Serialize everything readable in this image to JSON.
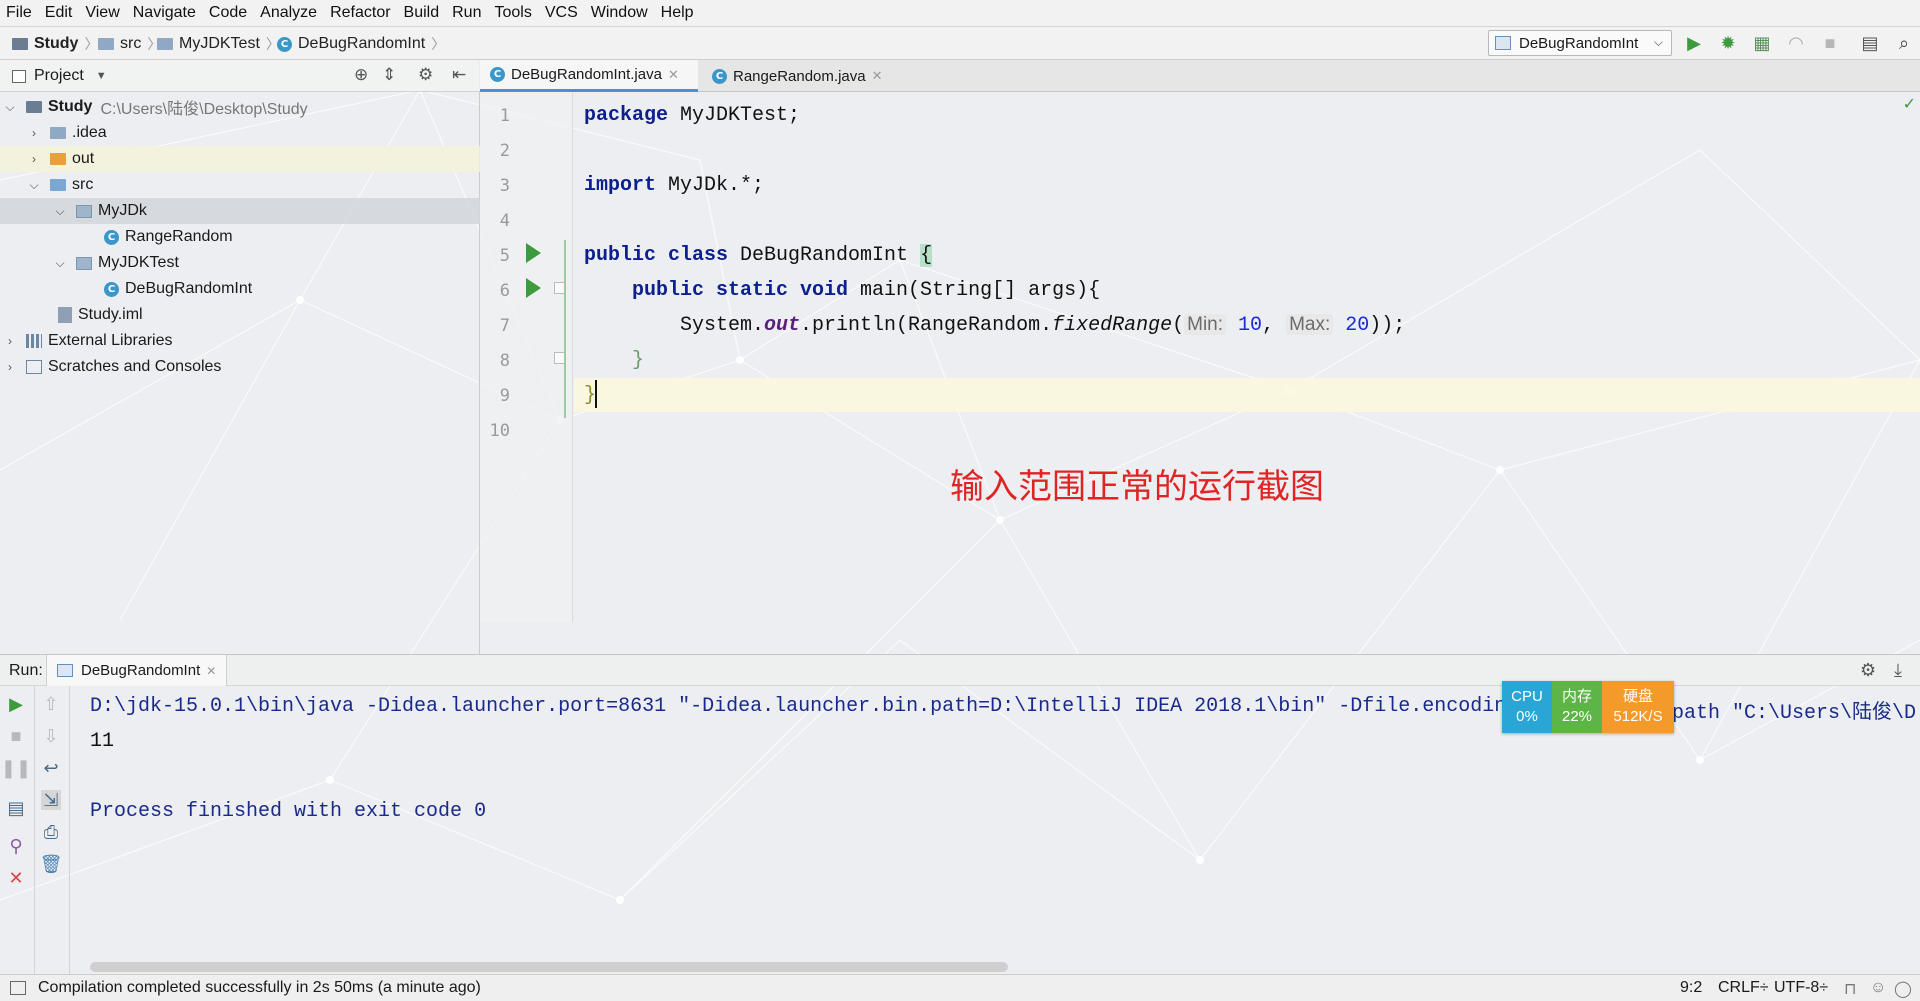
{
  "menu": [
    "File",
    "Edit",
    "View",
    "Navigate",
    "Code",
    "Analyze",
    "Refactor",
    "Build",
    "Run",
    "Tools",
    "VCS",
    "Window",
    "Help"
  ],
  "breadcrumbs": [
    "Study",
    "src",
    "MyJDKTest",
    "DeBugRandomInt"
  ],
  "run_config": "DeBugRandomInt",
  "project": {
    "title": "Project",
    "root_name": "Study",
    "root_path": "C:\\Users\\陆俊\\Desktop\\Study",
    "tree": [
      ".idea",
      "out",
      "src",
      "MyJDk",
      "RangeRandom",
      "MyJDKTest",
      "DeBugRandomInt",
      "Study.iml",
      "External Libraries",
      "Scratches and Consoles"
    ]
  },
  "editor": {
    "tabs": [
      "DeBugRandomInt.java",
      "RangeRandom.java"
    ],
    "line_numbers": [
      "1",
      "2",
      "3",
      "4",
      "5",
      "6",
      "7",
      "8",
      "9",
      "10"
    ],
    "code": {
      "l1_kw": "package",
      "l1_rest": " MyJDKTest;",
      "l3_kw": "import",
      "l3_rest": " MyJDk.*;",
      "l5_kw": "public class",
      "l5_name": " DeBugRandomInt ",
      "l5_brace": "{",
      "l6_kw": "public static void",
      "l6_rest": " main(String[] args){",
      "l7_a": "System.",
      "l7_out": "out",
      "l7_b": ".println(RangeRandom.",
      "l7_method": "fixedRange",
      "l7_c": "(",
      "hint_min": "Min:",
      "arg1": "10",
      "l7_comma": ", ",
      "hint_max": "Max:",
      "arg2": "20",
      "l7_end": "));",
      "l8": "}",
      "l9": "}"
    },
    "annotation": "输入范围正常的运行截图"
  },
  "run_panel": {
    "label": "Run:",
    "tab": "DeBugRandomInt",
    "output": [
      "D:\\jdk-15.0.1\\bin\\java -Didea.launcher.port=8631 \"-Didea.launcher.bin.path=D:\\IntelliJ IDEA 2018.1\\bin\" -Dfile.encodin",
      "11",
      "",
      "Process finished with exit code 0"
    ],
    "output_tail": "path \"C:\\Users\\陆俊\\D"
  },
  "monitor": {
    "cpu_label": "CPU",
    "cpu_value": "0%",
    "mem_label": "内存",
    "mem_value": "22%",
    "disk_label": "硬盘",
    "disk_value": "512K/S",
    "colors": {
      "cpu": "#2aa6d6",
      "mem": "#5cb545",
      "disk": "#f39a2b"
    }
  },
  "status": {
    "message": "Compilation completed successfully in 2s 50ms (a minute ago)",
    "position": "9:2",
    "line_sep": "CRLF÷",
    "encoding": "UTF-8÷"
  }
}
